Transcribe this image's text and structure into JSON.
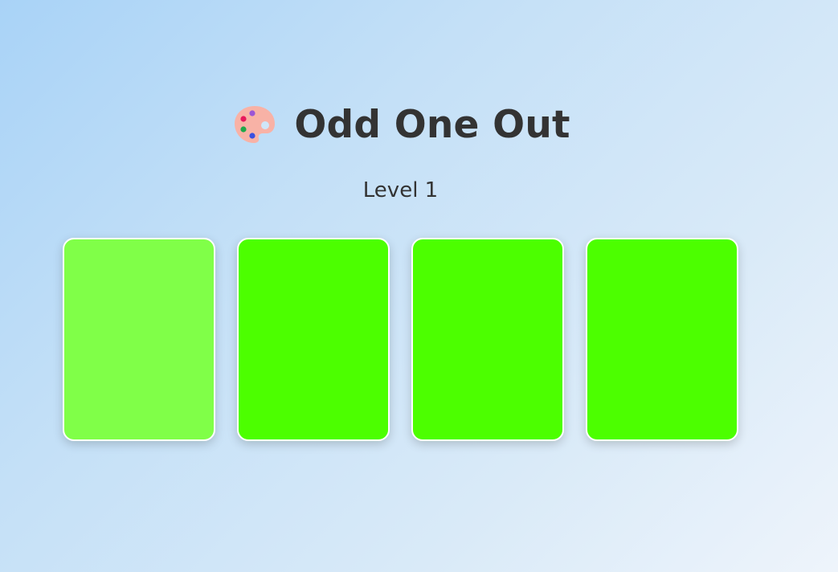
{
  "game": {
    "title": "Odd One Out",
    "level_label": "Level 1",
    "icon": "palette-icon"
  },
  "cards": [
    {
      "color": "#80ff48",
      "odd": true
    },
    {
      "color": "#4cff00",
      "odd": false
    },
    {
      "color": "#4cff00",
      "odd": false
    },
    {
      "color": "#4cff00",
      "odd": false
    }
  ]
}
